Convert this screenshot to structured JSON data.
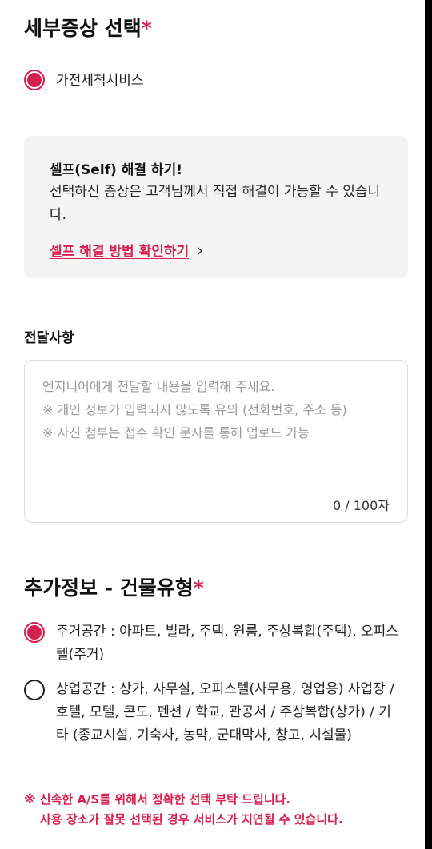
{
  "detail_symptom": {
    "heading": "세부증상 선택",
    "required_mark": "*",
    "selected_option": "가전세척서비스"
  },
  "self_fix": {
    "title": "셀프(Self) 해결 하기!",
    "description": "선택하신 증상은 고객님께서 직접 해결이 가능할 수 있습니다.",
    "link_label": "셀프 해결 방법 확인하기",
    "link_icon": "chevron-right-icon"
  },
  "memo": {
    "heading": "전달사항",
    "placeholder": "엔지니어에게 전달할 내용을 입력해 주세요.\n※ 개인 정보가 입력되지 않도록 유의 (전화번호, 주소 등)\n※ 사진 첨부는 접수 확인 문자를 통해 업로드 가능",
    "value": "",
    "counter": "0 / 100자"
  },
  "building_type": {
    "heading": "추가정보 - 건물유형",
    "required_mark": "*",
    "options": [
      {
        "label": "주거공간 : 아파트, 빌라, 주택, 원룸, 주상복합(주택), 오피스텔(주거)",
        "selected": true
      },
      {
        "label": "상업공간 : 상가, 사무실, 오피스텔(사무용, 영업용) 사업장 / 호텔, 모텔, 콘도, 펜션 / 학교, 관공서 / 주상복합(상가) / 기타 (종교시설, 기숙사, 농막, 군대막사, 창고, 시설물)",
        "selected": false
      }
    ]
  },
  "notice": {
    "line1": "※ 신속한 A/S를 위해서 정확한 선택 부탁 드립니다.",
    "line2": "사용 장소가 잘못 선택된 경우 서비스가 지연될 수 있습니다."
  },
  "colors": {
    "accent": "#d6204f",
    "box_bg": "#f4f4f4",
    "border": "#dcdcdc"
  }
}
